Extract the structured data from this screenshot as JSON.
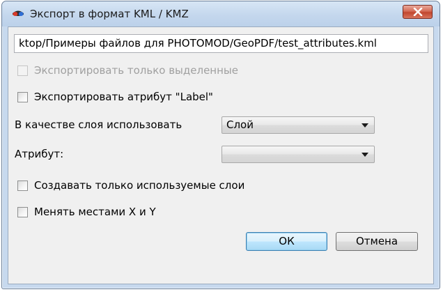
{
  "window": {
    "title": "Экспорт в формат KML / KMZ",
    "app_icon": "photomod-glasses-icon",
    "close_icon": "close-icon",
    "close_color": "#c8442e"
  },
  "path": {
    "value": "ktop/Примеры файлов для PHOTOMOD/GeoPDF/test_attributes.kml"
  },
  "options": {
    "export_selected": {
      "label": "Экспортировать только выделенные",
      "checked": false,
      "enabled": false
    },
    "export_label_attr": {
      "label": "Экспортировать атрибут \"Label\"",
      "checked": false,
      "enabled": true
    },
    "used_layers_only": {
      "label": "Создавать только используемые слои",
      "checked": false,
      "enabled": true
    },
    "swap_xy": {
      "label": "Менять местами X и Y",
      "checked": false,
      "enabled": true
    }
  },
  "layer_source": {
    "label": "В качестве слоя использовать",
    "selected": "Слой"
  },
  "attribute": {
    "label": "Атрибут:",
    "selected": ""
  },
  "buttons": {
    "ok": "ОК",
    "cancel": "Отмена"
  }
}
